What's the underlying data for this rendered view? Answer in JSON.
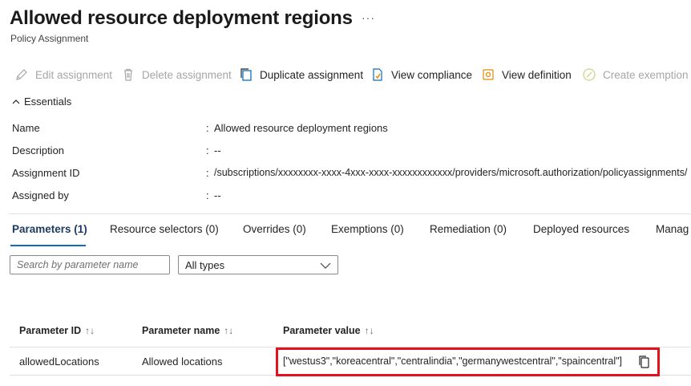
{
  "page": {
    "title": "Allowed resource deployment regions",
    "more": "···",
    "subtitle": "Policy Assignment"
  },
  "toolbar": {
    "edit_assignment": "Edit assignment",
    "delete_assignment": "Delete assignment",
    "duplicate_assignment": "Duplicate assignment",
    "view_compliance": "View compliance",
    "view_definition": "View definition",
    "create_exemption": "Create exemption"
  },
  "essentials": {
    "toggle_label": "Essentials",
    "rows": [
      {
        "label": "Name",
        "value": "Allowed resource deployment regions"
      },
      {
        "label": "Description",
        "value": "--"
      },
      {
        "label": "Assignment ID",
        "value": "/subscriptions/xxxxxxxx-xxxx-4xxx-xxxx-xxxxxxxxxxxx/providers/microsoft.authorization/policyassignments/"
      },
      {
        "label": "Assigned by",
        "value": "--"
      }
    ],
    "colon": ":"
  },
  "tabs": [
    {
      "label": "Parameters (1)"
    },
    {
      "label": "Resource selectors (0)"
    },
    {
      "label": "Overrides (0)"
    },
    {
      "label": "Exemptions (0)"
    },
    {
      "label": "Remediation (0)"
    },
    {
      "label": "Deployed resources"
    },
    {
      "label": "Manag"
    }
  ],
  "filters": {
    "search_placeholder": "Search by parameter name",
    "type_selected": "All types"
  },
  "table": {
    "headers": [
      "Parameter ID",
      "Parameter name",
      "Parameter value"
    ],
    "sort_glyph": "↑↓",
    "rows": [
      {
        "id": "allowedLocations",
        "name": "Allowed locations",
        "value": "[\"westus3\",\"koreacentral\",\"centralindia\",\"germanywestcentral\",\"spaincentral\"]"
      }
    ]
  },
  "colors": {
    "accent": "#0f6cbd",
    "highlight_border": "#e3121b",
    "disabled_text": "#a6a6a6"
  }
}
